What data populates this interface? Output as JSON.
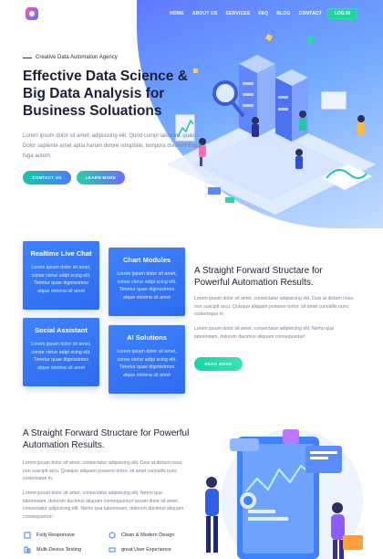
{
  "header": {
    "nav": [
      "HOME",
      "ABOUT US",
      "SERVICES",
      "FAQ",
      "BLOG",
      "CONTACT"
    ],
    "login_label": "LOG IN"
  },
  "hero": {
    "eyebrow": "Creative Data Automation Agency",
    "title": "Effective Data Science & Big Data Analysis for Business Soluations",
    "body": "Lorem ipsum dolor sit amet, adipisicing elit. Quod compl laborum, quasi? Dolor sapiente amet aptia harum dolore voluptate, tempora dolorem fugiat fuga autem.",
    "btn_contact": "CONTACT US",
    "btn_learn": "LEARN MORE"
  },
  "cards": [
    {
      "title": "Realtime Live Chat",
      "body": "Lorem ipsum dolor sit amet, conse ctetur adipi scing elit. Tenetur quae dignissimos atque minima sit amet"
    },
    {
      "title": "Chart Modules",
      "body": "Lorem ipsum dolor sit amet, conse ctetur adipi scing elit. Tenetur quae dignissimos atque minima sit amet"
    },
    {
      "title": "Social Assistant",
      "body": "Lorem ipsum dolor sit amet, conse ctetur adipi scing elit. Tenetur quae dignissimos atque minima sit amet"
    },
    {
      "title": "AI Solutions",
      "body": "Lorem ipsum dolor sit amet, conse ctetur adipi scing elit. Tenetur quae dignissimos atque minima sit amet"
    }
  ],
  "section2": {
    "title": "A Straight Forward Structare for Powerful Automation Results.",
    "p1": "Lorem ipsum dolor sit amet, consectatur adipisicing elit. Duis at dictum risus, non suscipit arcu. Quisque aliquam posuere tortor, sit amet convallis nunc scelerisque in.",
    "p2": "Lorem ipsum dolor sit amet, consectatur adipisicing elit. Nemo qua laboriosam, dolorum ducimus aliquam consequuntur!",
    "btn": "READ MORE"
  },
  "section3": {
    "title": "A Straight Forward Structare for Powerful Automation Results.",
    "p1": "Lorem ipsum dolor sit amet, consectatur adipisicing elit. Duis at dictum risus, non suscipit arcu. Quisque aliquam posuere tortor, sit amet convallis nunc scelerisque in.",
    "p2": "Lorem ipsum dolor sit amet, consectatur adipisicing elit. Nemo qua laboriosam, dolorum ducimus aliquam consequuntur! ipsum dolor sit amet, consectatur adipisicing elit. Nemo qua laboriosam, dolorum ducimus aliquam consequuntur!",
    "features": [
      "Fully Responsive",
      "Clean & Modern Design",
      "Multi-Device Testing",
      "great User Experience"
    ]
  },
  "colors": {
    "accent": "#3e82ff",
    "green": "#21d39d",
    "title": "#1d2036"
  }
}
